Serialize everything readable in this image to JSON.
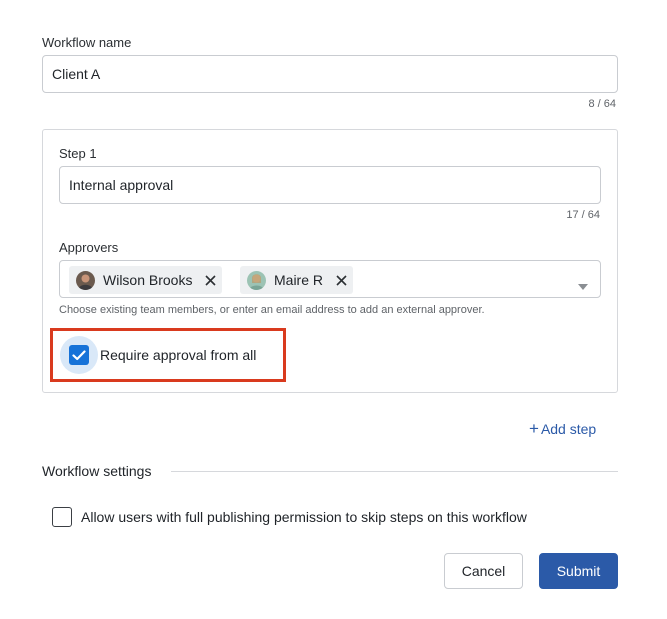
{
  "workflow_name": {
    "label": "Workflow name",
    "value": "Client A",
    "counter": "8 / 64"
  },
  "step": {
    "title": "Step 1",
    "name_value": "Internal approval",
    "name_counter": "17 / 64",
    "approvers_label": "Approvers",
    "approvers": [
      {
        "name": "Wilson Brooks"
      },
      {
        "name": "Maire R"
      }
    ],
    "approvers_helper": "Choose existing team members, or enter an email address to add an external approver.",
    "require_all": {
      "label": "Require approval from all",
      "checked": true
    }
  },
  "add_step": {
    "plus": "+",
    "label": "Add step"
  },
  "settings": {
    "title": "Workflow settings",
    "skip_option": {
      "label": "Allow users with full publishing permission to skip steps on this workflow",
      "checked": false
    }
  },
  "actions": {
    "cancel": "Cancel",
    "submit": "Submit"
  },
  "colors": {
    "accent": "#1672d8",
    "submit": "#2b5aa8",
    "highlight": "#d93a1e",
    "link": "#2b5aa8"
  }
}
